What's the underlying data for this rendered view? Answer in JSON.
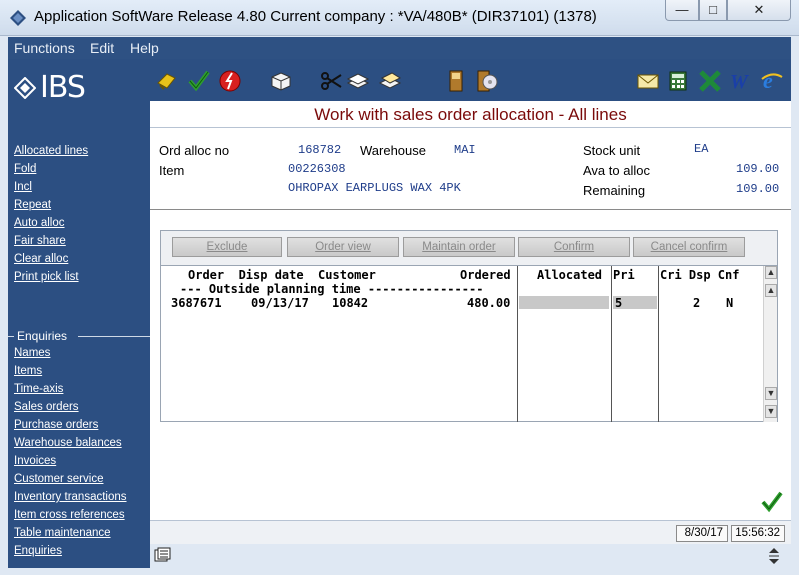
{
  "window": {
    "title": "Application SoftWare Release 4.80 Current company : *VA/480B* (DIR37101) (1378)",
    "min_glyph": "—",
    "max_glyph": "□",
    "close_glyph": "✕"
  },
  "menu": [
    "Functions",
    "Edit",
    "Help"
  ],
  "logo": "IBS",
  "sidebar": {
    "actions": [
      "Allocated lines",
      "Fold",
      "Incl",
      "Repeat",
      "Auto alloc",
      "Fair share",
      "Clear alloc",
      "Print pick list"
    ],
    "enquiries_label": "Enquiries",
    "enquiries": [
      "Names",
      "Items",
      "Time-axis",
      "Sales orders",
      "Purchase orders",
      "Warehouse balances",
      "Invoices",
      "Customer service",
      "Inventory transactions",
      "Item cross references",
      "Table maintenance",
      "Enquiries"
    ]
  },
  "toolbar_icons": [
    "key-icon",
    "check-icon",
    "cancel-icon",
    "package-icon",
    "scissors-icon",
    "stack-icon",
    "stack-open-icon",
    "book-icon",
    "disc-book-icon",
    "mail-icon",
    "calculator-icon",
    "excel-icon",
    "word-icon",
    "ie-icon"
  ],
  "screen_title": "Work with sales order allocation - All lines",
  "header": {
    "ord_alloc_label": "Ord alloc no",
    "ord_alloc_value": "168782",
    "warehouse_label": "Warehouse",
    "warehouse_value": "MAI",
    "item_label": "Item",
    "item_value": "00226308",
    "item_desc": "OHROPAX EARPLUGS WAX 4PK",
    "stock_unit_label": "Stock unit",
    "stock_unit_value": "EA",
    "ava_label": "Ava to alloc",
    "ava_value": "109.00",
    "remaining_label": "Remaining",
    "remaining_value": "109.00"
  },
  "actions": [
    "Exclude",
    "Order view",
    "Maintain order",
    "Confirm",
    "Cancel confirm"
  ],
  "columns": {
    "left": "Order  Disp date  Customer",
    "ordered": "Ordered",
    "allocated": "Allocated",
    "pri": "Pri",
    "right": "Cri Dsp Cnf"
  },
  "rows": {
    "section": "--- Outside planning time ----------------",
    "order": "3687671",
    "disp_date": "09/13/17",
    "customer": "10842",
    "ordered": "480.00",
    "pri": "5",
    "cri": "",
    "dsp": "2",
    "cnf": "N"
  },
  "status": {
    "date": "8/30/17",
    "time": "15:56:32"
  },
  "colors": {
    "sidebar": "#2c4f82",
    "title_red": "#7a0a0a",
    "value_blue": "#1f3d8a"
  }
}
